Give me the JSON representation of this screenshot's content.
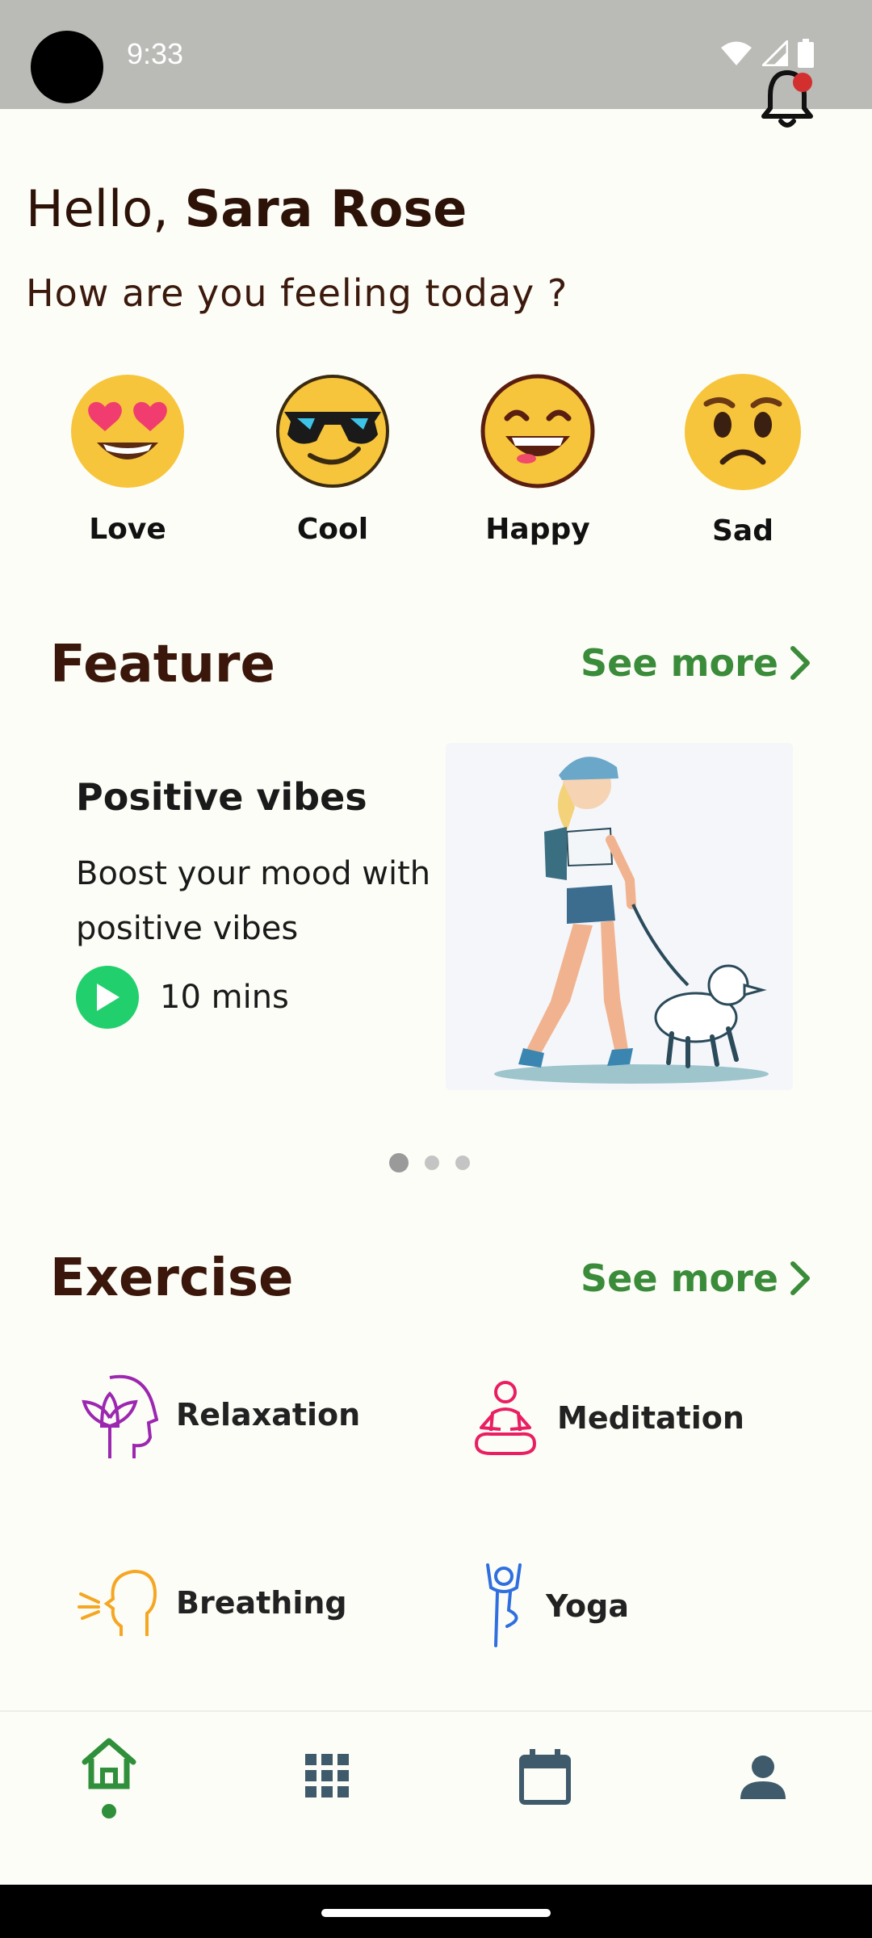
{
  "status_bar": {
    "time": "9:33"
  },
  "greeting": {
    "hello": "Hello,",
    "name": "Sara Rose",
    "question": "How are you feeling today ?"
  },
  "moods": [
    {
      "label": "Love",
      "icon": "heart-eyes-emoji"
    },
    {
      "label": "Cool",
      "icon": "sunglasses-emoji"
    },
    {
      "label": "Happy",
      "icon": "happy-emoji"
    },
    {
      "label": "Sad",
      "icon": "sad-emoji"
    }
  ],
  "feature": {
    "title": "Feature",
    "see_more": "See more",
    "card": {
      "title": "Positive vibes",
      "description": "Boost your mood with positive vibes",
      "duration": "10 mins"
    },
    "pager": {
      "count": 3,
      "active": 0
    }
  },
  "exercise": {
    "title": "Exercise",
    "see_more": "See more",
    "items": [
      {
        "label": "Relaxation",
        "icon": "head-lotus-icon",
        "color": "#9c27b0"
      },
      {
        "label": "Meditation",
        "icon": "meditation-icon",
        "color": "#e91e63"
      },
      {
        "label": "Breathing",
        "icon": "breathing-icon",
        "color": "#f5a623"
      },
      {
        "label": "Yoga",
        "icon": "yoga-icon",
        "color": "#2f6fe0"
      }
    ]
  },
  "nav": {
    "active": "home",
    "items": [
      "home-icon",
      "grid-icon",
      "calendar-icon",
      "profile-icon"
    ]
  },
  "colors": {
    "accent": "#3a8c3a",
    "play": "#21d06c",
    "heading": "#3a170a",
    "notification": "#d32f2f"
  }
}
